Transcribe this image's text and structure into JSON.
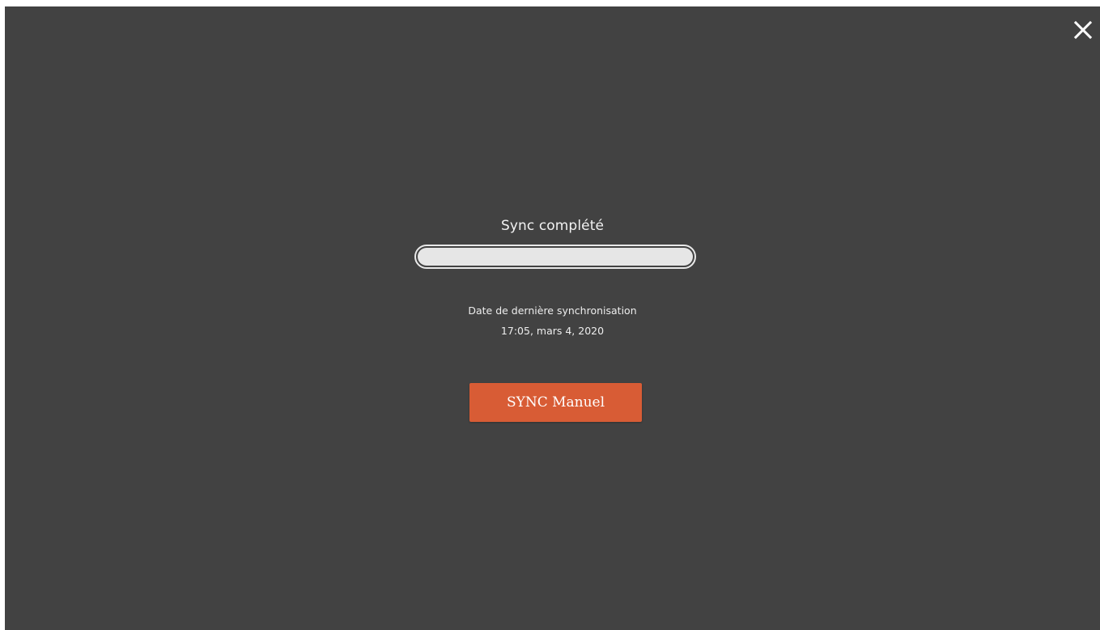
{
  "dialog": {
    "close_icon": "close-icon",
    "status_title": "Sync complété",
    "progress_fraction": 1.0,
    "last_sync_label": "Date de dernière synchronisation",
    "last_sync_date": "17:05, mars 4, 2020",
    "manual_sync_label": "SYNC Manuel"
  },
  "colors": {
    "background": "#424242",
    "accent": "#d85c35",
    "progress_fill": "#e6e6e6",
    "text": "#f2f2f2"
  }
}
